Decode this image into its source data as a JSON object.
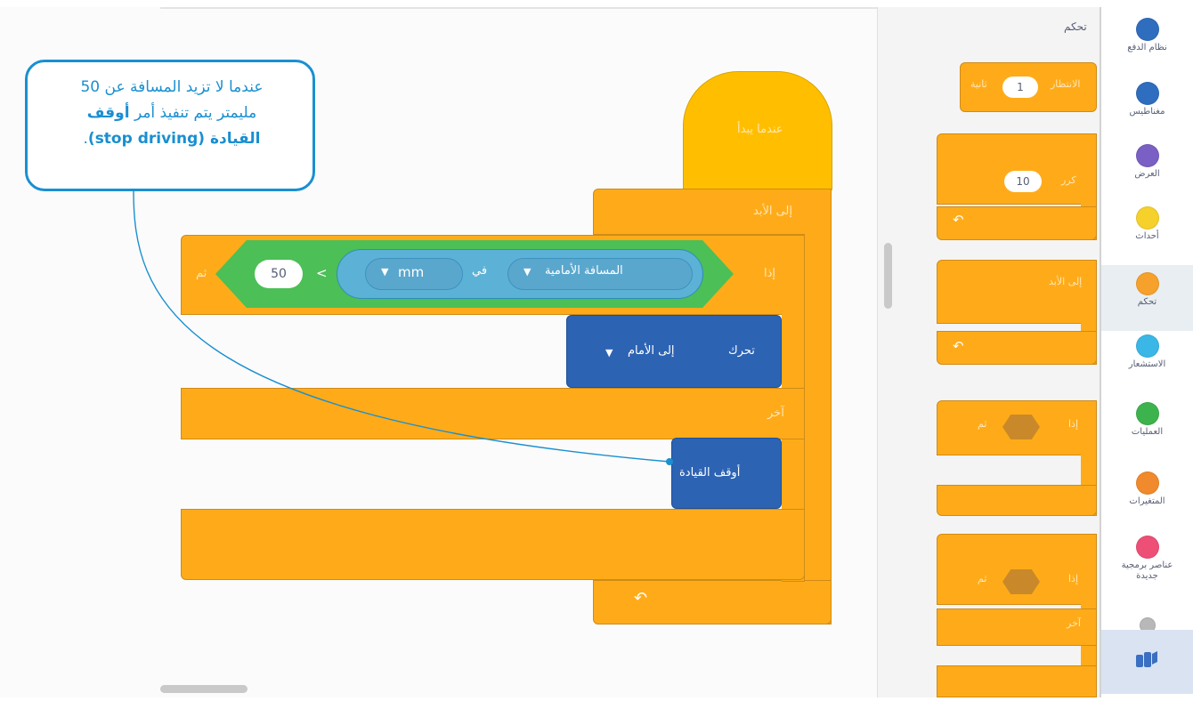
{
  "callout": {
    "line1": "عندما لا تزيد المسافة عن 50",
    "line2": "مليمتر يتم تنفيذ أمر",
    "bold_a": "أوقف",
    "bold_b": "القيادة (stop driving)",
    "end": "."
  },
  "script": {
    "hat_label": "عندما يبدأ",
    "forever_label": "إلى الأبد",
    "if_label": "إذا",
    "then_label": "ثم",
    "else_label": "آخر",
    "compare_value": "50",
    "compare_op": "<",
    "unit_label": "mm",
    "in_label": "في",
    "sensor_label": "المسافة الأمامية",
    "drive_label": "تحرك",
    "drive_dir": "إلى الأمام",
    "stop_label": "أوقف القيادة",
    "loop_arrow": "↶"
  },
  "palette": {
    "title": "تحكم",
    "wait_label": "الانتظار",
    "wait_value": "1",
    "wait_unit": "ثانية",
    "repeat_label": "كرر",
    "repeat_value": "10",
    "forever_label": "إلى الأبد",
    "if_label": "إذا",
    "then_label": "ثم",
    "else_label": "آخر",
    "arrow": "↶"
  },
  "categories": [
    {
      "label": "نظام الدفع",
      "color": "#2f6dbf"
    },
    {
      "label": "مغناطيس",
      "color": "#2f6dbf"
    },
    {
      "label": "العرض",
      "color": "#7a5fc4"
    },
    {
      "label": "أحداث",
      "color": "#f6d02b"
    },
    {
      "label": "تحكم",
      "color": "#f6a12b"
    },
    {
      "label": "الاستشعار",
      "color": "#3ab7e6"
    },
    {
      "label": "العمليات",
      "color": "#3db34d"
    },
    {
      "label": "المتغيرات",
      "color": "#f08a2c"
    },
    {
      "label": "عناصر برمجية جديدة",
      "color": "#ee4f76"
    },
    {
      "label": "",
      "color": "#b8b8b8"
    }
  ]
}
